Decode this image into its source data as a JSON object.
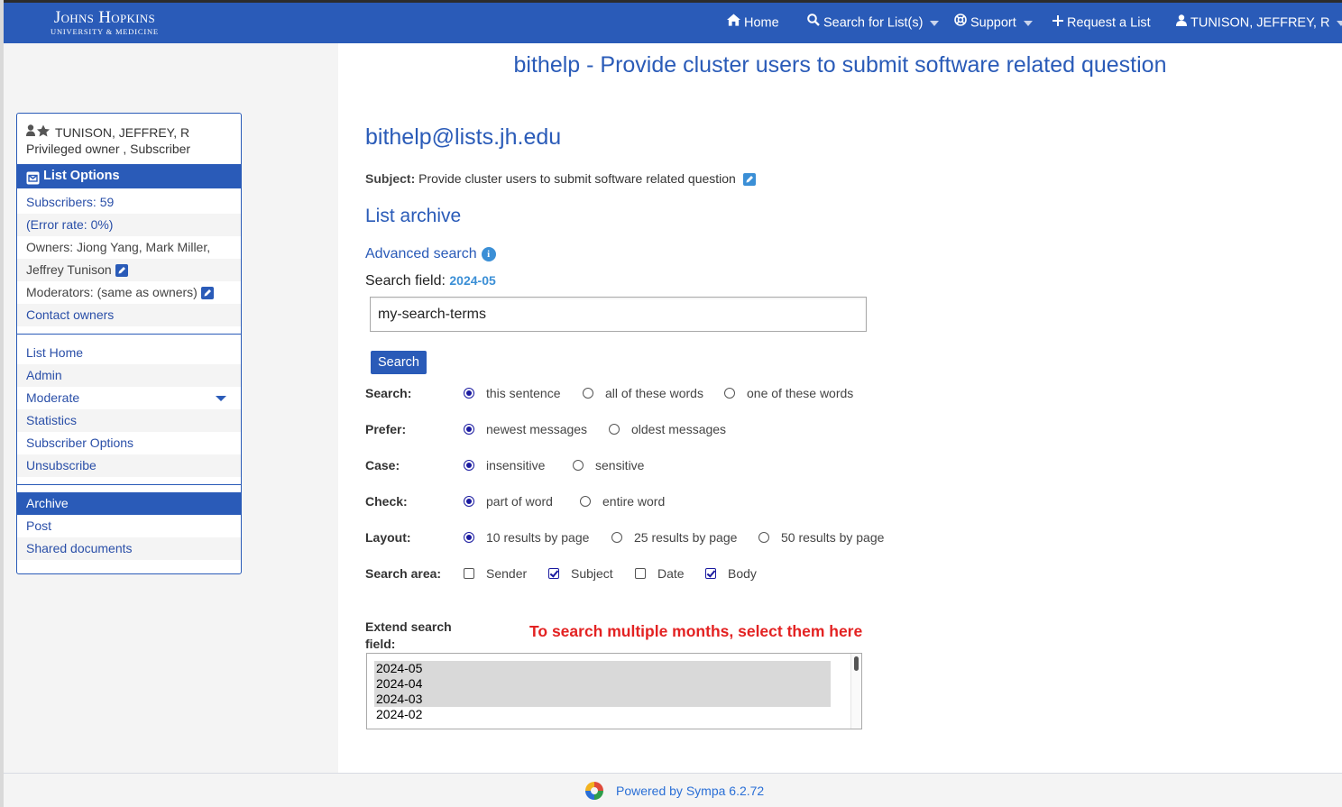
{
  "header": {
    "logo_line1": "Johns Hopkins",
    "logo_line2": "UNIVERSITY & MEDICINE",
    "nav": {
      "home": "Home",
      "search_lists": "Search for List(s)",
      "support": "Support",
      "request_list": "Request a List",
      "user": "TUNISON, JEFFREY, R"
    }
  },
  "sidebar": {
    "user_name": "TUNISON, JEFFREY, R",
    "user_roles": "Privileged owner , Subscriber",
    "list_options_title": "List Options",
    "subscribers": "Subscribers: 59",
    "error_rate": "(Error rate: 0%)",
    "owners_line1": "Owners: Jiong Yang, Mark Miller,",
    "owners_line2": "Jeffrey Tunison",
    "moderators": "Moderators: (same as owners)",
    "contact_owners": "Contact owners",
    "menu": {
      "list_home": "List Home",
      "admin": "Admin",
      "moderate": "Moderate",
      "statistics": "Statistics",
      "subscriber_options": "Subscriber Options",
      "unsubscribe": "Unsubscribe"
    },
    "menu2": {
      "archive": "Archive",
      "post": "Post",
      "shared_documents": "Shared documents"
    }
  },
  "main": {
    "page_title": "bithelp - Provide cluster users to submit software related question",
    "list_email": "bithelp@lists.jh.edu",
    "subject_label": "Subject:",
    "subject_value": "Provide cluster users to submit software related question",
    "archive_heading": "List archive",
    "advanced_search": "Advanced search",
    "search_field_label": "Search field:",
    "search_field_month": "2024-05",
    "search_input_value": "my-search-terms",
    "search_button": "Search",
    "options": {
      "search": {
        "label": "Search:",
        "choices": [
          "this sentence",
          "all of these words",
          "one of these words"
        ],
        "selected": "this sentence"
      },
      "prefer": {
        "label": "Prefer:",
        "choices": [
          "newest messages",
          "oldest messages"
        ],
        "selected": "newest messages"
      },
      "case": {
        "label": "Case:",
        "choices": [
          "insensitive",
          "sensitive"
        ],
        "selected": "insensitive"
      },
      "check": {
        "label": "Check:",
        "choices": [
          "part of word",
          "entire word"
        ],
        "selected": "part of word"
      },
      "layout": {
        "label": "Layout:",
        "choices": [
          "10 results by page",
          "25 results by page",
          "50 results by page"
        ],
        "selected": "10 results by page"
      },
      "area": {
        "label": "Search area:",
        "choices": [
          "Sender",
          "Subject",
          "Date",
          "Body"
        ],
        "checked": [
          "Subject",
          "Body"
        ]
      }
    },
    "extend_label": "Extend search field:",
    "hint": "To search multiple months, select them here",
    "months": [
      "2024-05",
      "2024-04",
      "2024-03",
      "2024-02"
    ],
    "selected_months": [
      "2024-05",
      "2024-04",
      "2024-03"
    ]
  },
  "footer": {
    "powered_by": "Powered by Sympa 6.2.72"
  },
  "colors": {
    "brand": "#2a5bb8",
    "hint": "#e32222",
    "panel": "#f4f4f4"
  }
}
